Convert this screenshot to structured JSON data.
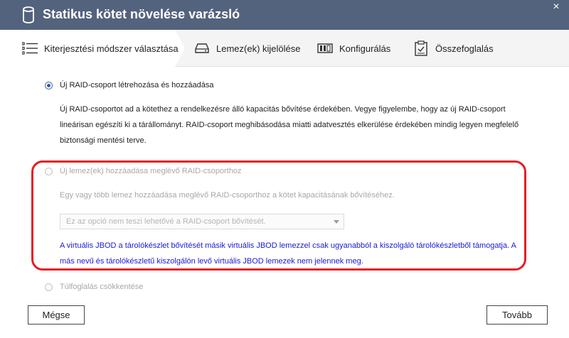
{
  "window": {
    "title": "Statikus kötet növelése varázsló",
    "close_glyph": "×"
  },
  "steps": [
    {
      "label": "Kiterjesztési módszer választása",
      "icon": "list-icon",
      "active": true
    },
    {
      "label": "Lemez(ek) kijelölése",
      "icon": "disk-icon",
      "active": false
    },
    {
      "label": "Konfigurálás",
      "icon": "config-icon",
      "active": false
    },
    {
      "label": "Összefoglalás",
      "icon": "clipboard-icon",
      "active": false
    }
  ],
  "options": {
    "new_raid": {
      "label": "Új RAID-csoport létrehozása és hozzáadása",
      "selected": true,
      "enabled": true,
      "description": "Új RAID-csoportot ad a kötethez a rendelkezésre álló kapacitás bővítése érdekében. Vegye figyelembe, hogy az új RAID-csoport lineárisan egészíti ki a tárállományt. RAID-csoport meghibásodása miatti adatvesztés elkerülése érdekében mindig legyen megfelelő biztonsági mentési terve."
    },
    "add_disks": {
      "label": "Új lemez(ek) hozzáadása meglévő RAID-csoporthoz",
      "selected": false,
      "enabled": false,
      "description": "Egy vagy több lemez hozzáadása meglévő RAID-csoporthoz a kötet kapacitásának bővítéséhez.",
      "select_value": "Ez az opció nem teszi lehetővé a RAID-csoport bővítését.",
      "note": "A virtuális JBOD a tárolókészlet bővítését másik virtuális JBOD lemezzel csak ugyanabból a kiszolgáló tárolókészletből támogatja. A más nevű és tárolókészletű kiszolgálón levő virtuális JBOD lemezek nem jelennek meg."
    },
    "reduce_overprov": {
      "label": "Túlfoglalás csökkentése",
      "selected": false,
      "enabled": false
    }
  },
  "buttons": {
    "cancel": "Mégse",
    "next": "Tovább"
  },
  "colors": {
    "titlebar": "#53637d",
    "highlight": "#e51e25",
    "note_text": "#1a1ad6",
    "active_step": "#ffffff"
  }
}
